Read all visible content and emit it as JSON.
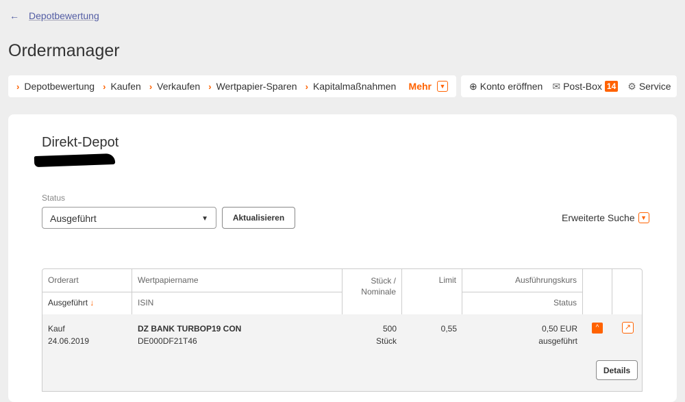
{
  "back": {
    "label": "Depotbewertung"
  },
  "page_title": "Ordermanager",
  "nav": {
    "items": [
      "Depotbewertung",
      "Kaufen",
      "Verkaufen",
      "Wertpapier-Sparen",
      "Kapitalmaßnahmen"
    ],
    "more": "Mehr"
  },
  "tools": {
    "open_account": "Konto eröffnen",
    "postbox": "Post-Box",
    "postbox_count": "14",
    "service": "Service"
  },
  "depot": {
    "title": "Direkt-Depot"
  },
  "filter": {
    "status_label": "Status",
    "status_value": "Ausgeführt",
    "refresh": "Aktualisieren",
    "advanced": "Erweiterte Suche"
  },
  "table": {
    "headers": {
      "orderart": "Orderart",
      "ausgefuehrt": "Ausgeführt",
      "wertpapier": "Wertpapiername",
      "isin": "ISIN",
      "stueck": "Stück /",
      "nominale": "Nominale",
      "limit": "Limit",
      "kurs": "Ausführungskurs",
      "status": "Status"
    },
    "rows": [
      {
        "orderart": "Kauf",
        "date": "24.06.2019",
        "name": "DZ BANK TURBOP19 CON",
        "isin": "DE000DF21T46",
        "qty": "500",
        "unit": "Stück",
        "limit": "0,55",
        "price": "0,50 EUR",
        "status": "ausgeführt",
        "details": "Details"
      }
    ]
  },
  "colors": {
    "accent": "#ff6200",
    "link": "#525ca3"
  }
}
